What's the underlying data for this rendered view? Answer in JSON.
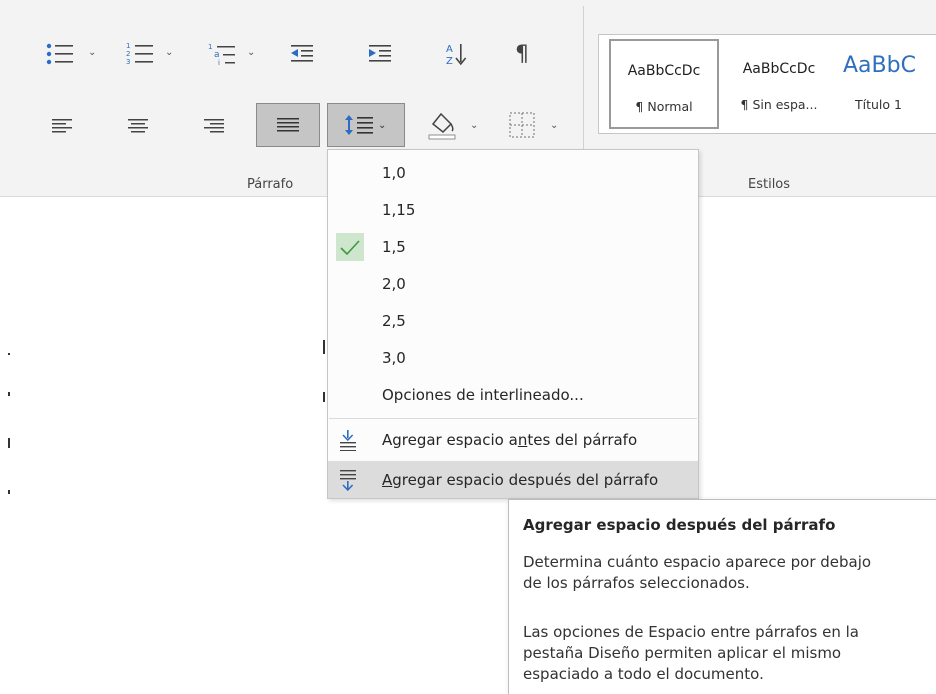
{
  "paragraph_group": {
    "label": "Párrafo",
    "row1": [
      {
        "name": "bullets",
        "icon": "bullet-list-icon",
        "has_dropdown": true
      },
      {
        "name": "numbering",
        "icon": "numbered-list-icon",
        "has_dropdown": true
      },
      {
        "name": "multilevel",
        "icon": "multilevel-list-icon",
        "has_dropdown": true
      },
      {
        "name": "decrease-indent",
        "icon": "decrease-indent-icon",
        "has_dropdown": false
      },
      {
        "name": "increase-indent",
        "icon": "increase-indent-icon",
        "has_dropdown": false
      },
      {
        "name": "sort",
        "icon": "sort-az-icon",
        "has_dropdown": false
      },
      {
        "name": "show-marks",
        "icon": "pilcrow-icon",
        "has_dropdown": false
      }
    ],
    "row2": [
      {
        "name": "align-left",
        "icon": "align-left-icon"
      },
      {
        "name": "align-center",
        "icon": "align-center-icon"
      },
      {
        "name": "align-right",
        "icon": "align-right-icon"
      },
      {
        "name": "justify",
        "icon": "justify-icon",
        "active": true
      },
      {
        "name": "line-spacing",
        "icon": "line-spacing-icon",
        "active": true,
        "open": true
      },
      {
        "name": "shading",
        "icon": "paint-bucket-icon"
      },
      {
        "name": "borders",
        "icon": "borders-icon"
      }
    ]
  },
  "styles_group": {
    "label": "Estilos",
    "styles": [
      {
        "sample": "AaBbCcDc",
        "name": "¶ Normal",
        "selected": true
      },
      {
        "sample": "AaBbCcDc",
        "name": "¶ Sin espa...",
        "selected": false
      },
      {
        "sample": "AaBbC",
        "name": "Título 1",
        "selected": false
      }
    ]
  },
  "line_spacing_menu": {
    "options": [
      "1,0",
      "1,15",
      "1,5",
      "2,0",
      "2,5",
      "3,0"
    ],
    "checked": "1,5",
    "options_link": "Opciones de interlineado...",
    "add_before": {
      "pre": "Agregar espacio a",
      "accel": "n",
      "post": "tes del párrafo"
    },
    "add_after": {
      "pre": "",
      "accel": "A",
      "post": "gregar espacio después del párrafo"
    }
  },
  "tooltip": {
    "title": "Agregar espacio después del párrafo",
    "line1": "Determina cuánto espacio aparece por debajo",
    "line2": "de los párrafos seleccionados.",
    "line3": "Las opciones de Espacio entre párrafos en la",
    "line4": "pestaña Diseño permiten aplicar el mismo",
    "line5": "espaciado a todo el documento."
  },
  "colors": {
    "ribbon_bg": "#f3f3f3",
    "accent_blue": "#2f6fbd",
    "check_green": "#3c9a3c",
    "hover_bg": "#dcdcdc"
  }
}
